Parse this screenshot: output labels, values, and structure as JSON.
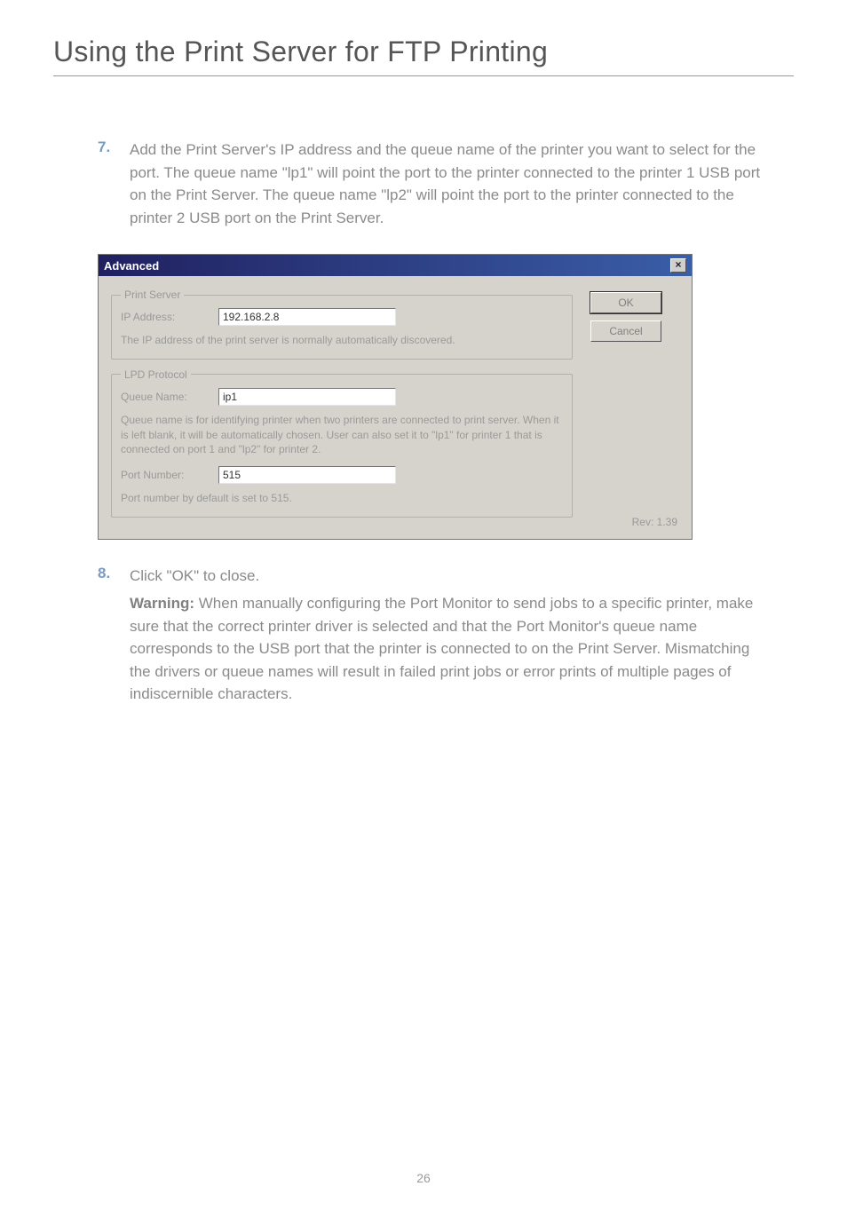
{
  "title": "Using the Print Server for FTP Printing",
  "step7": {
    "num": "7.",
    "text": "Add the Print Server's IP address and the queue name of the printer you want to select for the port. The queue name \"lp1\" will point the port to the printer connected to the printer 1 USB port on the Print Server. The queue name \"lp2\" will point the port to the printer connected to the printer 2 USB port on the Print Server."
  },
  "dialog": {
    "title": "Advanced",
    "close_glyph": "×",
    "ok_label": "OK",
    "cancel_label": "Cancel",
    "print_server": {
      "legend": "Print Server",
      "ip_label": "IP Address:",
      "ip_value": "192.168.2.8",
      "ip_note": "The IP address of the print server is normally automatically discovered."
    },
    "lpd": {
      "legend": "LPD Protocol",
      "queue_label": "Queue Name:",
      "queue_value": "ip1",
      "queue_note": "Queue name is for identifying printer when two printers are connected to print server. When it is left blank, it will be automatically chosen. User can also set it to \"lp1\" for printer 1 that is connected on port 1 and \"lp2\" for printer 2.",
      "port_label": "Port Number:",
      "port_value": "515",
      "port_note": "Port number by default is set to 515."
    },
    "rev": "Rev: 1.39"
  },
  "step8": {
    "num": "8.",
    "text": "Click \"OK\" to close."
  },
  "warning": {
    "label": "Warning:",
    "text": " When manually configuring the Port Monitor to send jobs to a specific printer, make sure that the correct printer driver is selected and that the Port Monitor's queue name corresponds to the USB port that the printer is connected to on the Print Server. Mismatching the drivers or queue names will result in failed print jobs or error prints of multiple pages of indiscernible characters."
  },
  "page_number": "26"
}
